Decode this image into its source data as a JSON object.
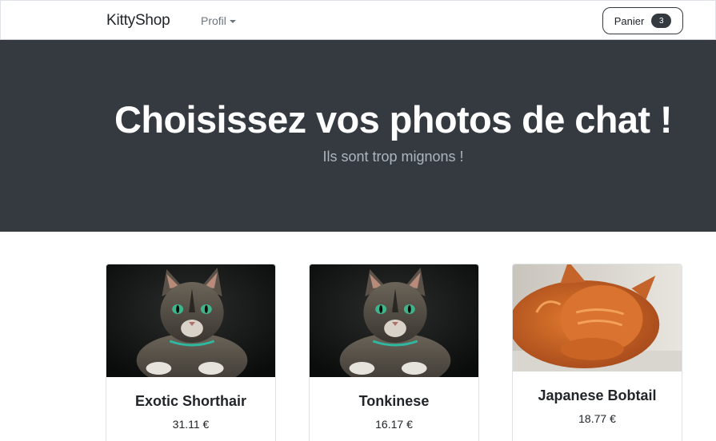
{
  "navbar": {
    "brand": "KittyShop",
    "profile_label": "Profil",
    "cart_label": "Panier",
    "cart_count": "3"
  },
  "hero": {
    "title": "Choisissez vos photos de chat !",
    "subtitle": "Ils sont trop mignons !"
  },
  "products": [
    {
      "name": "Exotic Shorthair",
      "price": "31.11 €",
      "image": "tabby-cat-photo"
    },
    {
      "name": "Tonkinese",
      "price": "16.17 €",
      "image": "tabby-cat-photo"
    },
    {
      "name": "Japanese Bobtail",
      "price": "18.77 €",
      "image": "orange-cat-photo"
    }
  ]
}
